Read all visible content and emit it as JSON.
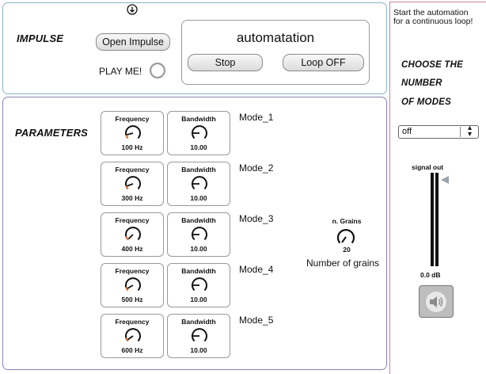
{
  "impulse": {
    "heading": "IMPULSE",
    "open_button": "Open Impulse",
    "play_label": "PLAY ME!",
    "arrow_icon": "circle-down-arrow"
  },
  "automation": {
    "title": "automatation",
    "stop_button": "Stop",
    "loop_button": "Loop OFF"
  },
  "parameters": {
    "heading": "PARAMETERS",
    "modes": [
      {
        "label": "Mode_1",
        "frequency_title": "Frequency",
        "frequency_value": "100 Hz",
        "bandwidth_title": "Bandwidth",
        "bandwidth_value": "10.00"
      },
      {
        "label": "Mode_2",
        "frequency_title": "Frequency",
        "frequency_value": "300 Hz",
        "bandwidth_title": "Bandwidth",
        "bandwidth_value": "10.00"
      },
      {
        "label": "Mode_3",
        "frequency_title": "Frequency",
        "frequency_value": "400 Hz",
        "bandwidth_title": "Bandwidth",
        "bandwidth_value": "10.00"
      },
      {
        "label": "Mode_4",
        "frequency_title": "Frequency",
        "frequency_value": "500 Hz",
        "bandwidth_title": "Bandwidth",
        "bandwidth_value": "10.00"
      },
      {
        "label": "Mode_5",
        "frequency_title": "Frequency",
        "frequency_value": "600 Hz",
        "bandwidth_title": "Bandwidth",
        "bandwidth_value": "10.00"
      }
    ],
    "grains": {
      "title": "n. Grains",
      "value": "20",
      "caption": "Number of grains"
    }
  },
  "right": {
    "intro_line1": "Start the automation",
    "intro_line2": "for a continuous loop!",
    "choose_line1": "CHOOSE THE",
    "choose_line2": "NUMBER",
    "choose_line3": "OF MODES",
    "menu_value": "off",
    "meter_label": "signal out",
    "db_value": "0.0 dB",
    "speaker_icon": "speaker-icon"
  },
  "colors": {
    "impulse_border": "#8bb3c8",
    "params_border": "#8f7fb8",
    "right_border": "#c77fa6",
    "dial_accent": "#e8743b"
  }
}
